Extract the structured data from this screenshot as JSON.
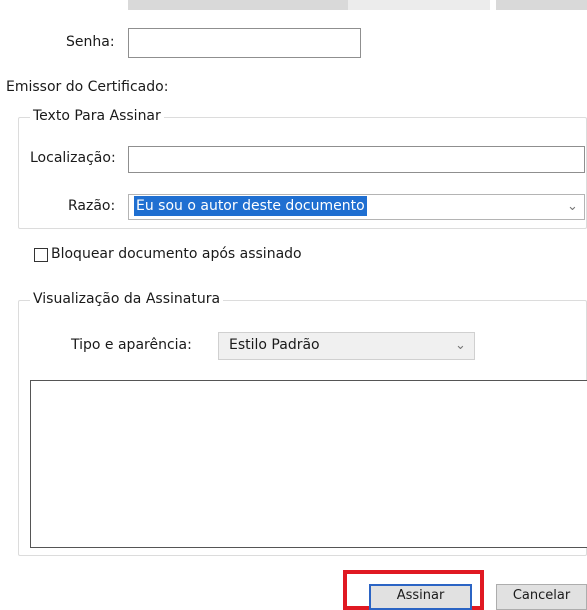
{
  "fields": {
    "password_label": "Senha:",
    "cert_issuer_label": "Emissor do Certificado:"
  },
  "sign_text_group": {
    "legend": "Texto Para Assinar",
    "location_label": "Localização:",
    "reason_label": "Razão:",
    "reason_value": "Eu sou o autor deste documento"
  },
  "lock_checkbox": {
    "label": "Bloquear documento após assinado",
    "checked": false
  },
  "signature_preview": {
    "legend": "Visualização da Assinatura",
    "type_label": "Tipo e aparência:",
    "type_value": "Estilo Padrão"
  },
  "buttons": {
    "sign": "Assinar",
    "cancel": "Cancelar"
  },
  "colors": {
    "highlight": "#e01922",
    "selection": "#1f6fd1"
  }
}
